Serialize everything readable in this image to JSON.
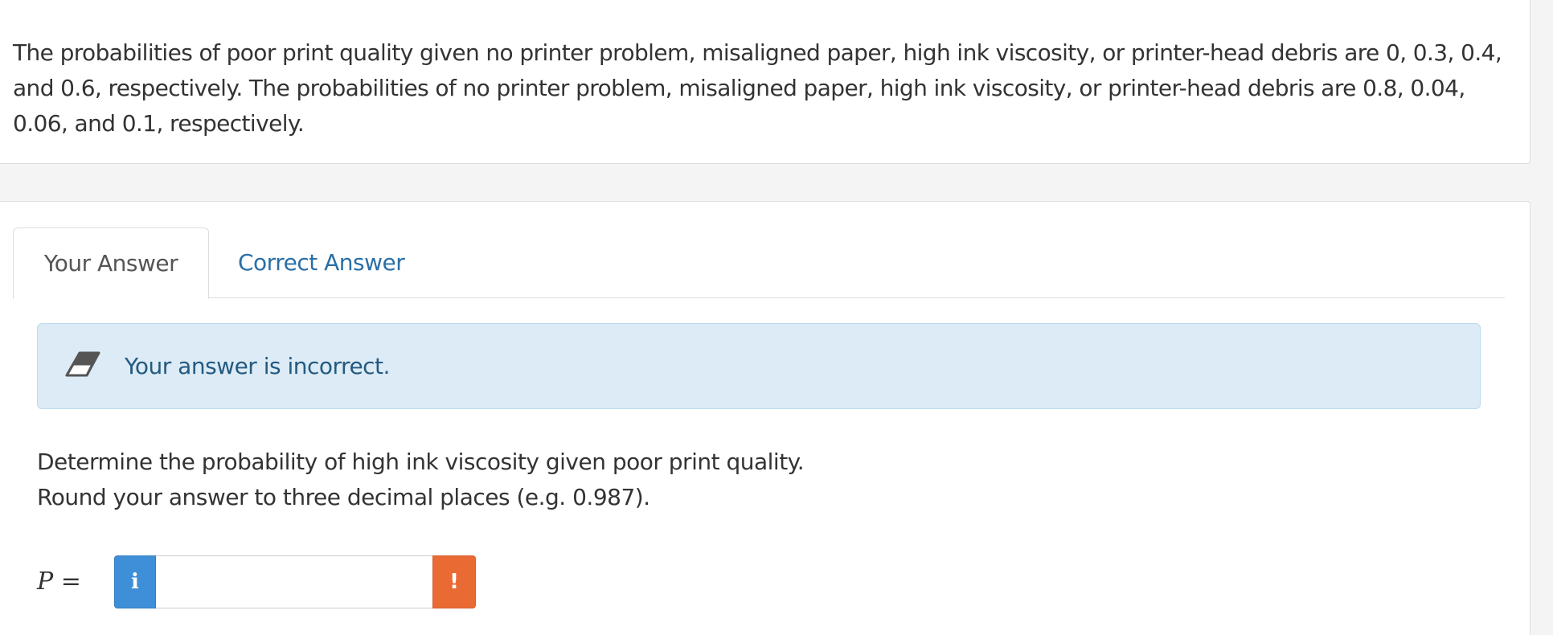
{
  "problem": {
    "text": "The probabilities of poor print quality given no printer problem, misaligned paper, high ink viscosity, or printer-head debris are 0, 0.3, 0.4, and 0.6, respectively. The probabilities of no printer problem, misaligned paper, high ink viscosity, or printer-head debris are 0.8, 0.04, 0.06, and 0.1, respectively."
  },
  "tabs": [
    {
      "label": "Your Answer",
      "active": true
    },
    {
      "label": "Correct Answer",
      "active": false
    }
  ],
  "alert": {
    "icon": "eraser-icon",
    "text": "Your answer is incorrect."
  },
  "question": {
    "line1": "Determine the probability of high ink viscosity given poor print quality.",
    "line2": "Round your answer to three decimal places (e.g. 0.987)."
  },
  "answer": {
    "variable": "P",
    "equals": "=",
    "info_icon_glyph": "i",
    "info_icon": "info-icon",
    "value": "",
    "warning_glyph": "!",
    "warning_icon": "warning-icon"
  },
  "colors": {
    "link": "#2a6ea6",
    "alert_bg": "#dcebf5",
    "alert_text": "#245a80",
    "info_button": "#3e8ed8",
    "warning_button": "#ea6a34"
  }
}
